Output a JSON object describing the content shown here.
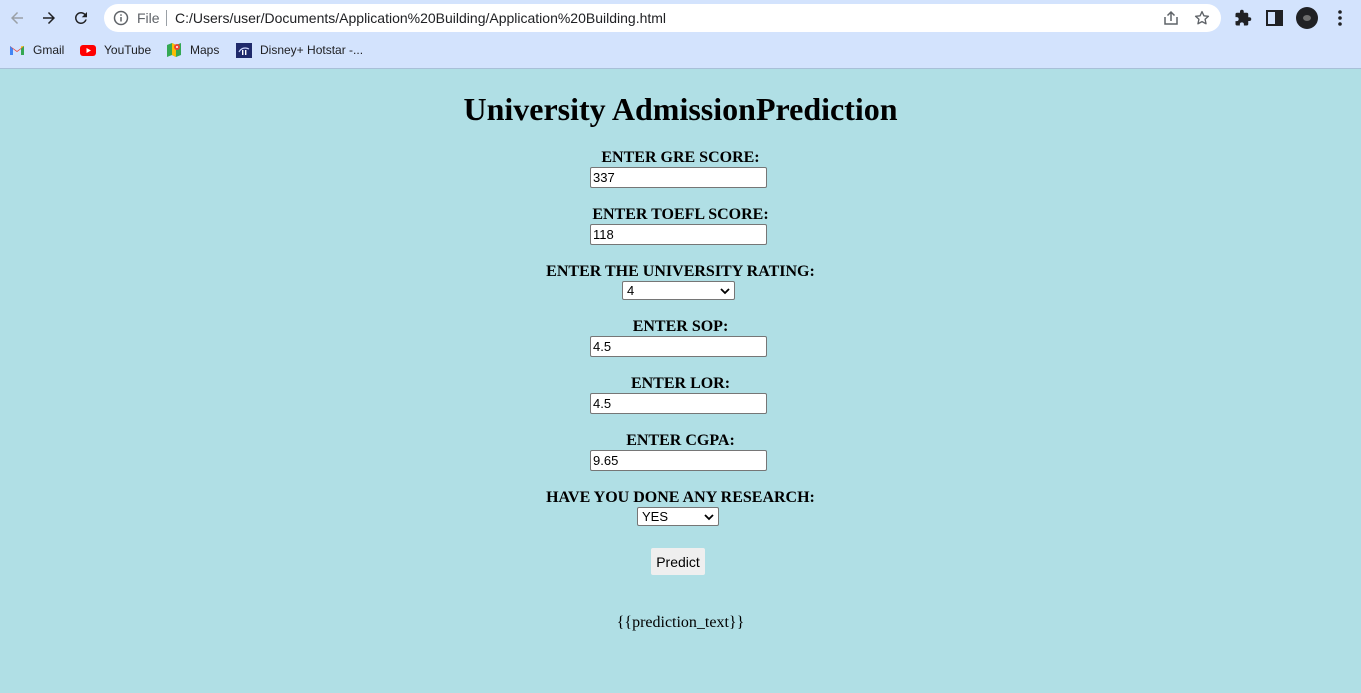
{
  "browser": {
    "omnibox": {
      "scheme_label": "File",
      "url": "C:/Users/user/Documents/Application%20Building/Application%20Building.html"
    },
    "bookmarks": [
      {
        "label": "Gmail",
        "icon": "gmail-icon"
      },
      {
        "label": "YouTube",
        "icon": "youtube-icon"
      },
      {
        "label": "Maps",
        "icon": "maps-icon"
      },
      {
        "label": "Disney+ Hotstar -...",
        "icon": "hotstar-icon"
      }
    ]
  },
  "page": {
    "title": "University AdmissionPrediction",
    "fields": [
      {
        "label": "ENTER GRE SCORE:",
        "value": "337"
      },
      {
        "label": "ENTER TOEFL SCORE:",
        "value": "118"
      },
      {
        "label": "ENTER THE UNIVERSITY RATING:",
        "value": "4"
      },
      {
        "label": "ENTER SOP:",
        "value": "4.5"
      },
      {
        "label": "ENTER LOR:",
        "value": "4.5"
      },
      {
        "label": "ENTER CGPA:",
        "value": "9.65"
      },
      {
        "label": "HAVE YOU DONE ANY RESEARCH:",
        "value": "YES"
      }
    ],
    "predict_label": "Predict",
    "prediction_text": "{{prediction_text}}"
  },
  "colors": {
    "page_background": "#b0dfe5",
    "chrome_background": "#d3e3fd"
  }
}
